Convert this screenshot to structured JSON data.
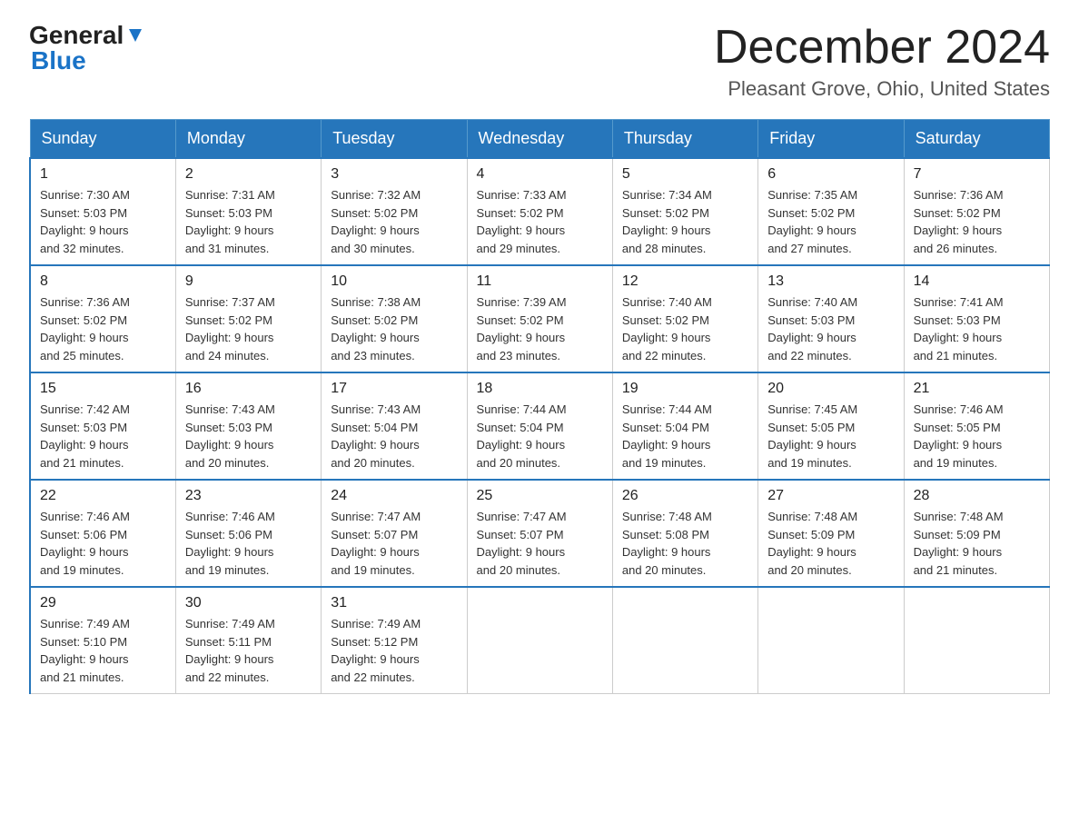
{
  "header": {
    "logo_general": "General",
    "logo_blue": "Blue",
    "month_title": "December 2024",
    "location": "Pleasant Grove, Ohio, United States"
  },
  "days_of_week": [
    "Sunday",
    "Monday",
    "Tuesday",
    "Wednesday",
    "Thursday",
    "Friday",
    "Saturday"
  ],
  "weeks": [
    [
      {
        "day": "1",
        "sunrise": "7:30 AM",
        "sunset": "5:03 PM",
        "daylight": "9 hours and 32 minutes."
      },
      {
        "day": "2",
        "sunrise": "7:31 AM",
        "sunset": "5:03 PM",
        "daylight": "9 hours and 31 minutes."
      },
      {
        "day": "3",
        "sunrise": "7:32 AM",
        "sunset": "5:02 PM",
        "daylight": "9 hours and 30 minutes."
      },
      {
        "day": "4",
        "sunrise": "7:33 AM",
        "sunset": "5:02 PM",
        "daylight": "9 hours and 29 minutes."
      },
      {
        "day": "5",
        "sunrise": "7:34 AM",
        "sunset": "5:02 PM",
        "daylight": "9 hours and 28 minutes."
      },
      {
        "day": "6",
        "sunrise": "7:35 AM",
        "sunset": "5:02 PM",
        "daylight": "9 hours and 27 minutes."
      },
      {
        "day": "7",
        "sunrise": "7:36 AM",
        "sunset": "5:02 PM",
        "daylight": "9 hours and 26 minutes."
      }
    ],
    [
      {
        "day": "8",
        "sunrise": "7:36 AM",
        "sunset": "5:02 PM",
        "daylight": "9 hours and 25 minutes."
      },
      {
        "day": "9",
        "sunrise": "7:37 AM",
        "sunset": "5:02 PM",
        "daylight": "9 hours and 24 minutes."
      },
      {
        "day": "10",
        "sunrise": "7:38 AM",
        "sunset": "5:02 PM",
        "daylight": "9 hours and 23 minutes."
      },
      {
        "day": "11",
        "sunrise": "7:39 AM",
        "sunset": "5:02 PM",
        "daylight": "9 hours and 23 minutes."
      },
      {
        "day": "12",
        "sunrise": "7:40 AM",
        "sunset": "5:02 PM",
        "daylight": "9 hours and 22 minutes."
      },
      {
        "day": "13",
        "sunrise": "7:40 AM",
        "sunset": "5:03 PM",
        "daylight": "9 hours and 22 minutes."
      },
      {
        "day": "14",
        "sunrise": "7:41 AM",
        "sunset": "5:03 PM",
        "daylight": "9 hours and 21 minutes."
      }
    ],
    [
      {
        "day": "15",
        "sunrise": "7:42 AM",
        "sunset": "5:03 PM",
        "daylight": "9 hours and 21 minutes."
      },
      {
        "day": "16",
        "sunrise": "7:43 AM",
        "sunset": "5:03 PM",
        "daylight": "9 hours and 20 minutes."
      },
      {
        "day": "17",
        "sunrise": "7:43 AM",
        "sunset": "5:04 PM",
        "daylight": "9 hours and 20 minutes."
      },
      {
        "day": "18",
        "sunrise": "7:44 AM",
        "sunset": "5:04 PM",
        "daylight": "9 hours and 20 minutes."
      },
      {
        "day": "19",
        "sunrise": "7:44 AM",
        "sunset": "5:04 PM",
        "daylight": "9 hours and 19 minutes."
      },
      {
        "day": "20",
        "sunrise": "7:45 AM",
        "sunset": "5:05 PM",
        "daylight": "9 hours and 19 minutes."
      },
      {
        "day": "21",
        "sunrise": "7:46 AM",
        "sunset": "5:05 PM",
        "daylight": "9 hours and 19 minutes."
      }
    ],
    [
      {
        "day": "22",
        "sunrise": "7:46 AM",
        "sunset": "5:06 PM",
        "daylight": "9 hours and 19 minutes."
      },
      {
        "day": "23",
        "sunrise": "7:46 AM",
        "sunset": "5:06 PM",
        "daylight": "9 hours and 19 minutes."
      },
      {
        "day": "24",
        "sunrise": "7:47 AM",
        "sunset": "5:07 PM",
        "daylight": "9 hours and 19 minutes."
      },
      {
        "day": "25",
        "sunrise": "7:47 AM",
        "sunset": "5:07 PM",
        "daylight": "9 hours and 20 minutes."
      },
      {
        "day": "26",
        "sunrise": "7:48 AM",
        "sunset": "5:08 PM",
        "daylight": "9 hours and 20 minutes."
      },
      {
        "day": "27",
        "sunrise": "7:48 AM",
        "sunset": "5:09 PM",
        "daylight": "9 hours and 20 minutes."
      },
      {
        "day": "28",
        "sunrise": "7:48 AM",
        "sunset": "5:09 PM",
        "daylight": "9 hours and 21 minutes."
      }
    ],
    [
      {
        "day": "29",
        "sunrise": "7:49 AM",
        "sunset": "5:10 PM",
        "daylight": "9 hours and 21 minutes."
      },
      {
        "day": "30",
        "sunrise": "7:49 AM",
        "sunset": "5:11 PM",
        "daylight": "9 hours and 22 minutes."
      },
      {
        "day": "31",
        "sunrise": "7:49 AM",
        "sunset": "5:12 PM",
        "daylight": "9 hours and 22 minutes."
      },
      null,
      null,
      null,
      null
    ]
  ],
  "labels": {
    "sunrise": "Sunrise:",
    "sunset": "Sunset:",
    "daylight": "Daylight:"
  }
}
